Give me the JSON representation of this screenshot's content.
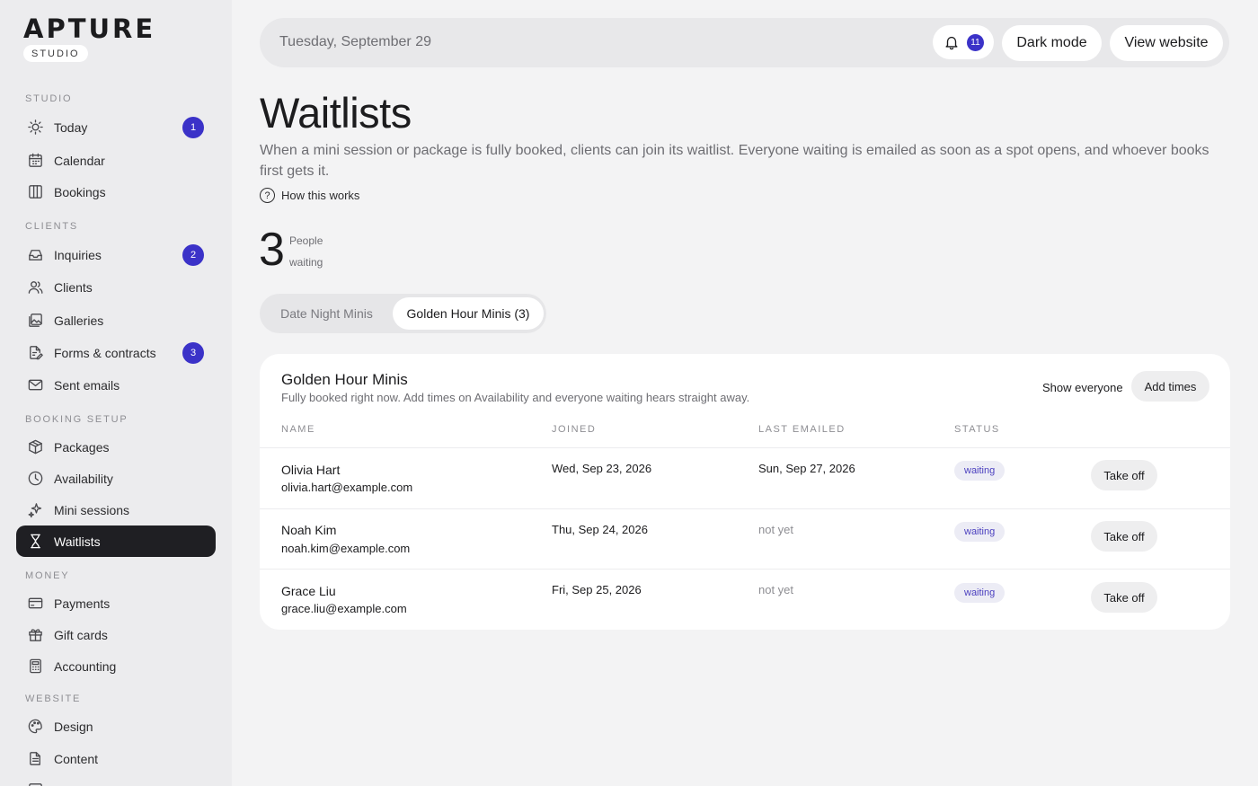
{
  "brand": {
    "name": "APTURE",
    "tag": "STUDIO"
  },
  "sidebar": {
    "sections": [
      {
        "label": "STUDIO"
      },
      {
        "label": "CLIENTS"
      },
      {
        "label": "BOOKING SETUP"
      },
      {
        "label": "MONEY"
      },
      {
        "label": "WEBSITE"
      }
    ],
    "items": [
      {
        "label": "Today",
        "badge": "1",
        "icon": "sun-icon"
      },
      {
        "label": "Calendar",
        "icon": "calendar-icon"
      },
      {
        "label": "Bookings",
        "icon": "columns-icon"
      },
      {
        "label": "Inquiries",
        "badge": "2",
        "icon": "inbox-icon"
      },
      {
        "label": "Clients",
        "icon": "users-icon"
      },
      {
        "label": "Galleries",
        "icon": "gallery-icon"
      },
      {
        "label": "Forms & contracts",
        "badge": "3",
        "icon": "form-icon"
      },
      {
        "label": "Sent emails",
        "icon": "mail-icon"
      },
      {
        "label": "Packages",
        "icon": "package-icon"
      },
      {
        "label": "Availability",
        "icon": "clock-icon"
      },
      {
        "label": "Mini sessions",
        "icon": "sparkle-icon"
      },
      {
        "label": "Waitlists",
        "icon": "hourglass-icon",
        "active": true
      },
      {
        "label": "Payments",
        "icon": "credit-card-icon"
      },
      {
        "label": "Gift cards",
        "icon": "gift-icon"
      },
      {
        "label": "Accounting",
        "icon": "calculator-icon"
      },
      {
        "label": "Design",
        "icon": "palette-icon"
      },
      {
        "label": "Content",
        "icon": "document-icon"
      }
    ]
  },
  "topbar": {
    "date": "Tuesday, September 29",
    "notification_count": "11",
    "dark_mode_label": "Dark mode",
    "view_website_label": "View website"
  },
  "header": {
    "title": "Waitlists",
    "description": "When a mini session or package is fully booked, clients can join its waitlist. Everyone waiting is emailed as soon as a spot opens, and whoever books first gets it.",
    "how_link": "How this works",
    "help_glyph": "?"
  },
  "stat": {
    "count": "3",
    "label_line1": "People",
    "label_line2": "waiting"
  },
  "tabs": [
    {
      "label": "Date Night Minis"
    },
    {
      "label": "Golden Hour Minis (3)",
      "selected": true
    }
  ],
  "card": {
    "title": "Golden Hour Minis",
    "subtitle": "Fully booked right now. Add times on Availability and everyone waiting hears straight away.",
    "show_everyone": "Show everyone",
    "add_times": "Add times",
    "columns": [
      "NAME",
      "JOINED",
      "LAST EMAILED",
      "STATUS"
    ],
    "rows": [
      {
        "name": "Olivia Hart",
        "email": "olivia.hart@example.com",
        "joined": "Wed, Sep 23, 2026",
        "last_emailed": "Sun, Sep 27, 2026",
        "status": "waiting",
        "action": "Take off"
      },
      {
        "name": "Noah Kim",
        "email": "noah.kim@example.com",
        "joined": "Thu, Sep 24, 2026",
        "last_emailed": "not yet",
        "status": "waiting",
        "action": "Take off"
      },
      {
        "name": "Grace Liu",
        "email": "grace.liu@example.com",
        "joined": "Fri, Sep 25, 2026",
        "last_emailed": "not yet",
        "status": "waiting",
        "action": "Take off"
      }
    ]
  },
  "colors": {
    "accent": "#3b32c8",
    "active_nav": "#1f1f23",
    "status_text": "#4a3fbf"
  }
}
